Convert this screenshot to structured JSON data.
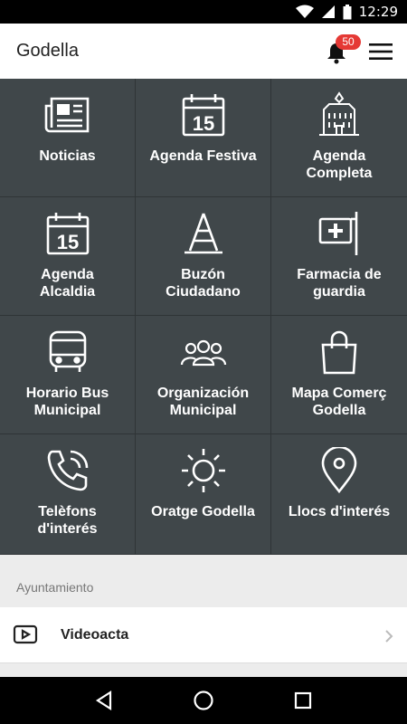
{
  "status_bar": {
    "time": "12:29"
  },
  "app_bar": {
    "title": "Godella",
    "notification_count": "50"
  },
  "tiles": [
    {
      "label": "Noticias",
      "icon": "newspaper-icon"
    },
    {
      "label": "Agenda Festiva",
      "icon": "calendar-icon",
      "day": "15"
    },
    {
      "label": "Agenda\nCompleta",
      "icon": "town-hall-building-icon"
    },
    {
      "label": "Agenda\nAlcaldia",
      "icon": "calendar-icon",
      "day": "15"
    },
    {
      "label": "Buzón\nCiudadano",
      "icon": "traffic-cone-icon"
    },
    {
      "label": "Farmacia de\nguardia",
      "icon": "pharmacy-sign-icon"
    },
    {
      "label": "Horario Bus\nMunicipal",
      "icon": "bus-icon"
    },
    {
      "label": "Organización\nMunicipal",
      "icon": "group-people-icon"
    },
    {
      "label": "Mapa Comerç\nGodella",
      "icon": "shopping-bag-icon"
    },
    {
      "label": "Telèfons\nd'interés",
      "icon": "phone-icon"
    },
    {
      "label": "Oratge Godella",
      "icon": "sun-icon"
    },
    {
      "label": "Llocs d'interés",
      "icon": "map-pin-icon"
    }
  ],
  "section": {
    "title": "Ayuntamiento"
  },
  "list": [
    {
      "label": "Videoacta",
      "icon": "video-play-icon"
    }
  ],
  "colors": {
    "grid_bg": "#40474a",
    "badge": "#e53935",
    "background": "#ececec"
  }
}
